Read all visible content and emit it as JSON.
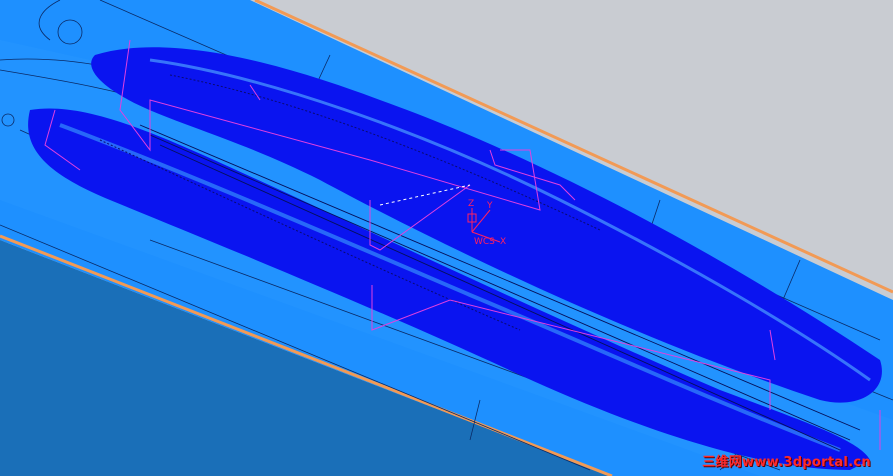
{
  "viewport": {
    "background_color": "#c9ccd2",
    "mold_top_color": "#1e90ff",
    "mold_side_color": "#1a78c8",
    "edge_highlight_color": "#f29a55",
    "cavity_color": "#0a14f0",
    "toolpath_color": "#e040e0"
  },
  "csys": {
    "z_label": "Z",
    "y_label": "Y",
    "x_label": "X",
    "wcs_label": "WCS"
  },
  "watermark": {
    "text": "三维网www.3dportal.cn",
    "color": "#ff2b2b"
  }
}
